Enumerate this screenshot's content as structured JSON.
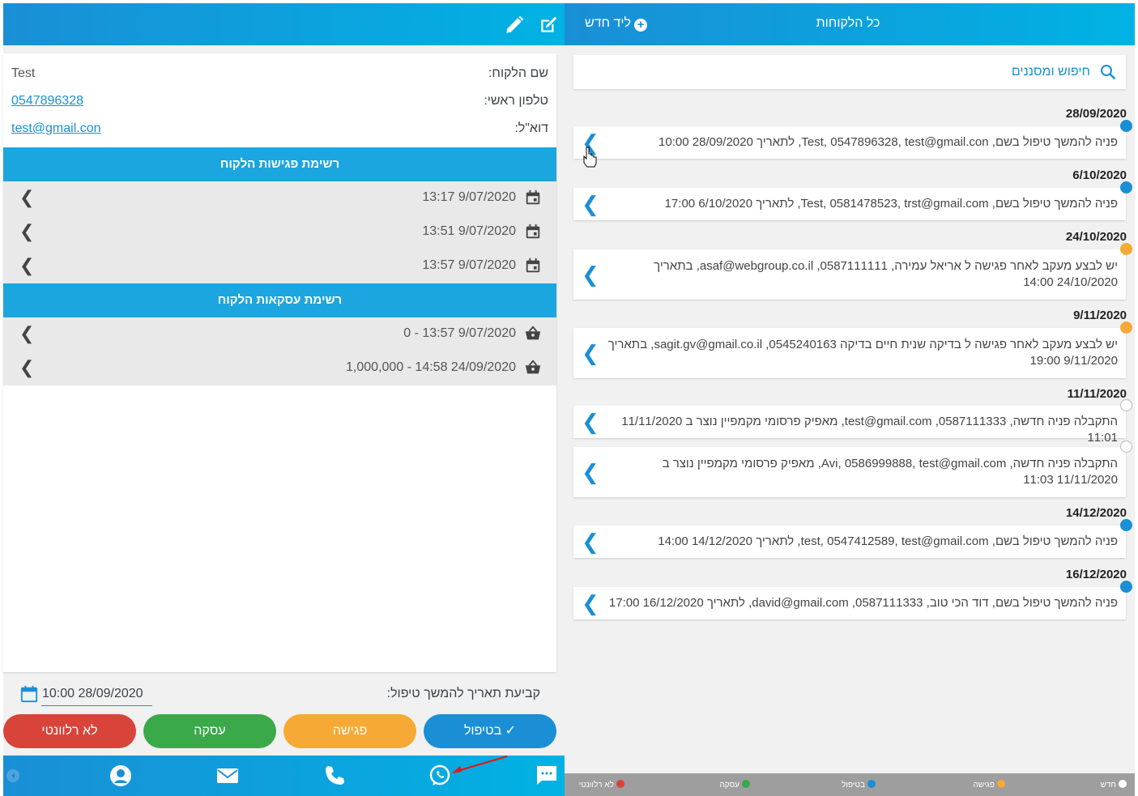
{
  "colors": {
    "brand": "#1a8fd6",
    "brand_light": "#00b2e3",
    "treating": "#1a8fd6",
    "meeting": "#f6a934",
    "deal": "#3aa94a",
    "irrelevant": "#d9443a",
    "new": "#ffffff"
  },
  "detail": {
    "fields": [
      {
        "label": "שם הלקוח:",
        "value": "Test"
      },
      {
        "label": "טלפון ראשי:",
        "value": "0547896328"
      },
      {
        "label": "דוא\"ל:",
        "value": "test@gmail.con"
      }
    ],
    "meetings_title": "רשימת פגישות הלקוח",
    "meetings": [
      {
        "text": "13:17 9/07/2020"
      },
      {
        "text": "13:51 9/07/2020"
      },
      {
        "text": "13:57 9/07/2020"
      }
    ],
    "deals_title": "רשימת עסקאות הלקוח",
    "deals": [
      {
        "text": "0 - 13:57 9/07/2020"
      },
      {
        "text": "1,000,000 - 14:58 24/09/2020"
      }
    ],
    "followup_label": "קביעת תאריך להמשך טיפול:",
    "followup_value": "10:00 28/09/2020",
    "buttons": {
      "treating": "✓ בטיפול",
      "meeting": "פגישה",
      "deal": "עסקה",
      "irrelevant": "לא רלוונטי"
    }
  },
  "list": {
    "title": "כל הלקוחות",
    "new_lead": "ליד חדש",
    "search": "חיפוש ומסננים",
    "groups": [
      {
        "date": "28/09/2020",
        "entries": [
          {
            "status": "treating",
            "text": "פניה להמשך טיפול בשם, Test, 0547896328, test@gmail.con, לתאריך 28/09/2020 10:00"
          }
        ]
      },
      {
        "date": "6/10/2020",
        "entries": [
          {
            "status": "treating",
            "text": "פניה להמשך טיפול בשם, Test, 0581478523, trst@gmail.com, לתאריך 6/10/2020 17:00"
          }
        ]
      },
      {
        "date": "24/10/2020",
        "entries": [
          {
            "status": "meeting",
            "text": "יש לבצע מעקב לאחר פגישה ל אריאל עמירה, 0587111111, asaf@webgroup.co.il, בתאריך 24/10/2020 14:00"
          }
        ]
      },
      {
        "date": "9/11/2020",
        "entries": [
          {
            "status": "meeting",
            "text": "יש לבצע מעקב לאחר פגישה ל בדיקה שנית חיים בדיקה 0545240163, sagit.gv@gmail.co.il, בתאריך 9/11/2020 19:00"
          }
        ]
      },
      {
        "date": "11/11/2020",
        "entries": [
          {
            "status": "new",
            "text": "התקבלה פניה חדשה, 0587111333, test@gmail.com, מאפיק פרסומי מקמפיין נוצר ב 11/11/2020 11:01"
          },
          {
            "status": "new",
            "text": "התקבלה פניה חדשה, Avi, 0586999888, test@gmail.com, מאפיק פרסומי מקמפיין נוצר ב 11/11/2020 11:03"
          }
        ]
      },
      {
        "date": "14/12/2020",
        "entries": [
          {
            "status": "treating",
            "text": "פניה להמשך טיפול בשם, test, 0547412589, test@gmail.com, לתאריך 14/12/2020 14:00"
          }
        ]
      },
      {
        "date": "16/12/2020",
        "entries": [
          {
            "status": "treating",
            "text": "פניה להמשך טיפול בשם, דוד הכי טוב, 0587111333, david@gmail.com, לתאריך 16/12/2020 17:00"
          }
        ]
      }
    ],
    "legend": [
      {
        "label": "חדש",
        "status": "new"
      },
      {
        "label": "פגישה",
        "status": "meeting"
      },
      {
        "label": "בטיפול",
        "status": "treating"
      },
      {
        "label": "עסקה",
        "status": "deal"
      },
      {
        "label": "לא רלוונטי",
        "status": "irrelevant"
      }
    ]
  },
  "icons": {
    "top": [
      "edit-square-icon",
      "pencil-icon"
    ],
    "bottom": [
      "chat-icon",
      "whatsapp-icon",
      "phone-icon",
      "mail-icon",
      "contact-icon",
      "back-icon"
    ]
  }
}
